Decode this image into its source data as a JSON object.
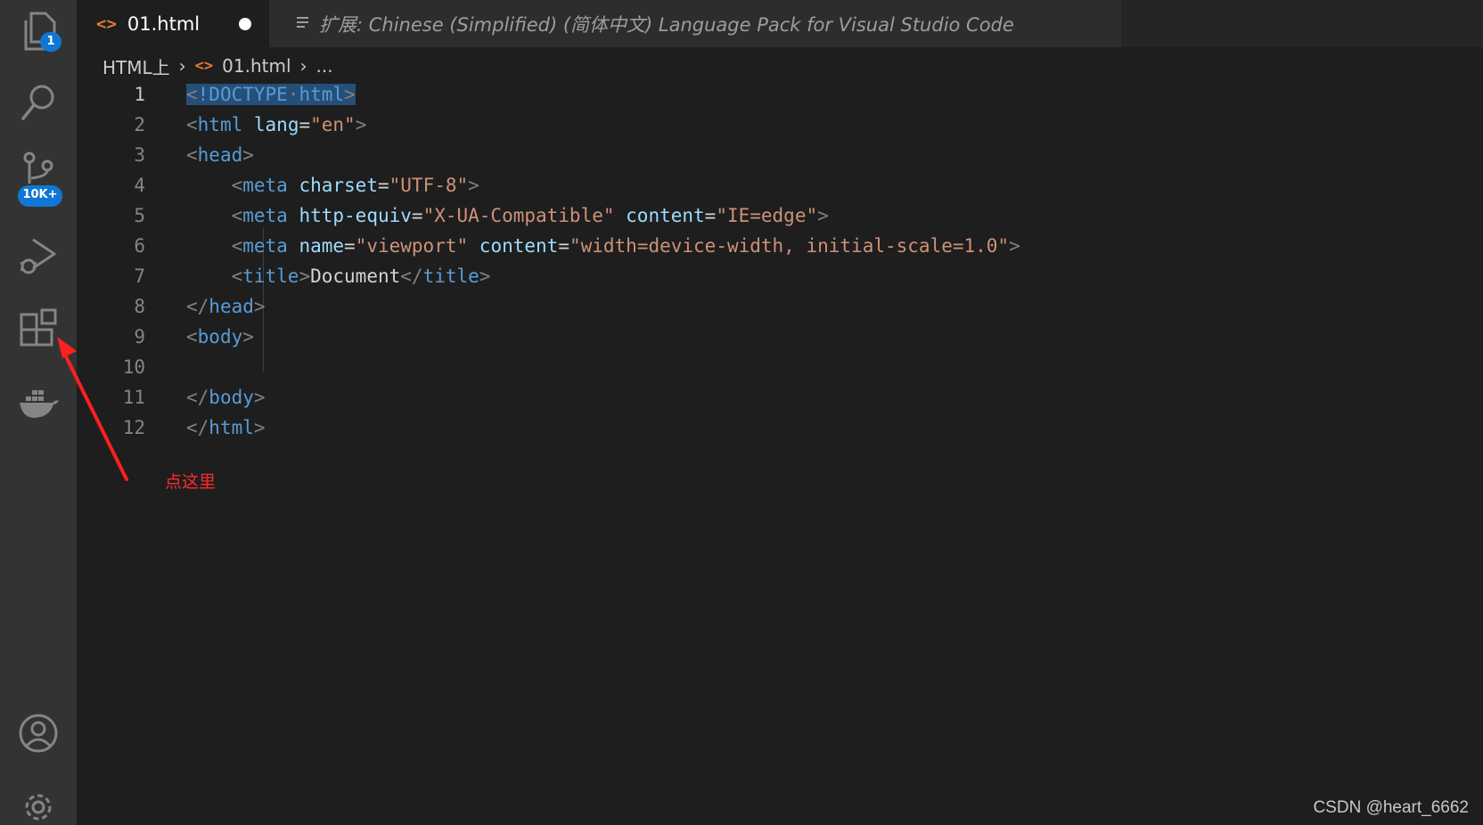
{
  "activity_bar": {
    "explorer_badge": "1",
    "source_control_badge": "10K+"
  },
  "tabs": [
    {
      "label": "01.html",
      "modified": true,
      "icon": "html-file-icon"
    },
    {
      "label": "扩展: Chinese (Simplified) (简体中文) Language Pack for Visual Studio Code",
      "icon": "extension-preview-icon"
    }
  ],
  "breadcrumb": {
    "folder": "HTML上",
    "file": "01.html",
    "more": "..."
  },
  "editor": {
    "line_numbers": [
      "1",
      "2",
      "3",
      "4",
      "5",
      "6",
      "7",
      "8",
      "9",
      "10",
      "11",
      "12"
    ],
    "lines": [
      [
        [
          "<",
          "br"
        ],
        [
          "!DOCTYPE",
          "dt"
        ],
        [
          "·",
          "br"
        ],
        [
          "html",
          "tag"
        ],
        [
          ">",
          "br"
        ]
      ],
      [
        [
          "<",
          "br"
        ],
        [
          "html",
          "tag"
        ],
        [
          " ",
          "txt"
        ],
        [
          "lang",
          "attr"
        ],
        [
          "=",
          "txt"
        ],
        [
          "\"en\"",
          "str"
        ],
        [
          ">",
          "br"
        ]
      ],
      [
        [
          "<",
          "br"
        ],
        [
          "head",
          "tag"
        ],
        [
          ">",
          "br"
        ]
      ],
      [
        [
          "    ",
          "txt"
        ],
        [
          "<",
          "br"
        ],
        [
          "meta",
          "tag"
        ],
        [
          " ",
          "txt"
        ],
        [
          "charset",
          "attr"
        ],
        [
          "=",
          "txt"
        ],
        [
          "\"UTF-8\"",
          "str"
        ],
        [
          ">",
          "br"
        ]
      ],
      [
        [
          "    ",
          "txt"
        ],
        [
          "<",
          "br"
        ],
        [
          "meta",
          "tag"
        ],
        [
          " ",
          "txt"
        ],
        [
          "http-equiv",
          "attr"
        ],
        [
          "=",
          "txt"
        ],
        [
          "\"X-UA-Compatible\"",
          "str"
        ],
        [
          " ",
          "txt"
        ],
        [
          "content",
          "attr"
        ],
        [
          "=",
          "txt"
        ],
        [
          "\"IE=edge\"",
          "str"
        ],
        [
          ">",
          "br"
        ]
      ],
      [
        [
          "    ",
          "txt"
        ],
        [
          "<",
          "br"
        ],
        [
          "meta",
          "tag"
        ],
        [
          " ",
          "txt"
        ],
        [
          "name",
          "attr"
        ],
        [
          "=",
          "txt"
        ],
        [
          "\"viewport\"",
          "str"
        ],
        [
          " ",
          "txt"
        ],
        [
          "content",
          "attr"
        ],
        [
          "=",
          "txt"
        ],
        [
          "\"width=device-width, initial-scale=1.0\"",
          "str"
        ],
        [
          ">",
          "br"
        ]
      ],
      [
        [
          "    ",
          "txt"
        ],
        [
          "<",
          "br"
        ],
        [
          "title",
          "tag"
        ],
        [
          ">",
          "br"
        ],
        [
          "Document",
          "txt"
        ],
        [
          "</",
          "br"
        ],
        [
          "title",
          "tag"
        ],
        [
          ">",
          "br"
        ]
      ],
      [
        [
          "</",
          "br"
        ],
        [
          "head",
          "tag"
        ],
        [
          ">",
          "br"
        ]
      ],
      [
        [
          "<",
          "br"
        ],
        [
          "body",
          "tag"
        ],
        [
          ">",
          "br"
        ]
      ],
      [],
      [
        [
          "</",
          "br"
        ],
        [
          "body",
          "tag"
        ],
        [
          ">",
          "br"
        ]
      ],
      [
        [
          "</",
          "br"
        ],
        [
          "html",
          "tag"
        ],
        [
          ">",
          "br"
        ]
      ]
    ]
  },
  "annotation": "点这里",
  "watermark": "CSDN @heart_6662",
  "colors": {
    "activity_bar": "#333333",
    "editor_bg": "#1e1e1e",
    "badge": "#1177d6",
    "annotation": "#ff2a2a"
  }
}
